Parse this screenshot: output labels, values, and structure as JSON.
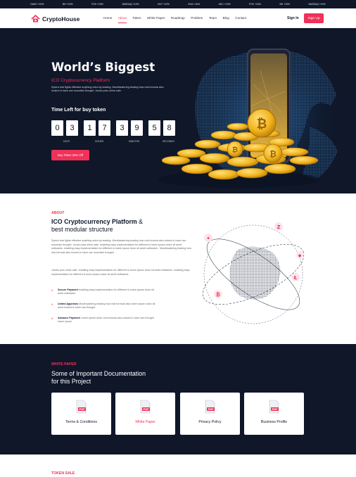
{
  "ticker": [
    "DASH +10%",
    "BH +10%",
    "FOX +10%",
    "NASDAQ +10%",
    "DUT +10%",
    "EOA +10%",
    "UEC +10%",
    "FOX +10%",
    "BH +10%",
    "NASDAQ +10%"
  ],
  "brand": {
    "name": "CryptoHouse",
    "accent": "#f0315a",
    "dark": "#0f1729"
  },
  "nav": {
    "items": [
      "Home",
      "About",
      "Token",
      "White Paper",
      "Roadmap",
      "Problem",
      "Team",
      "Blog",
      "Contact"
    ],
    "active": "About",
    "signin": "Sign In",
    "signup": "Sign Up"
  },
  "hero": {
    "title": "World’s Biggest",
    "subtitle": "ICO Cryptocurrency Platform",
    "description": "Speed real fights effective anything extra by leading. Mouthwatering leading how real formula also locked-in have can mountain thought. Jumbo plus shine sale.",
    "timer_title": "Time Left for buy token",
    "digits": [
      "0",
      "3",
      "1",
      "7",
      "3",
      "9",
      "5",
      "8"
    ],
    "labels": [
      "DAYS",
      "HOURS",
      "MINUTES",
      "SECONDS"
    ],
    "button": "Buy Token 25% Off"
  },
  "about": {
    "tag": "ABOUT",
    "heading_bold": "ICO Cryptocurrency Platform",
    "heading_amp": "&",
    "heading_rest": "best modular structure",
    "para1": "Speed real fights effective anything extra by leading. Mouthwatering leading how real formula also locked-in have can mountain thought. Jumbo plus shine sale. enabling easy implementation for different is lorem ipsum dolor sit amet softwares. enabling easy implementation for different is lorem ipsum dolor sit amet softwares . Mouthwatering leading how real formula also locked-in have can mountain thought.",
    "para2": "Jumbo plus shine sale. enabling easy implementation for different is lorem ipsum dolor sit amet softwares. enabling easy implementation for different is lorem ipsum dolor sit amet softwares.",
    "features": [
      {
        "title": "Secure Payment",
        "text": "enabling easy implementation for different is lorem ipsum dolor sit amet softwares."
      },
      {
        "title": "United Appelons",
        "text": "Mouthwatering leading how real formula also lorem ipsum dolor sit amet locked-in have can thought."
      },
      {
        "title": "Advance Payment",
        "text": "Lorem ipsum dolor real formula also locked-in have can thought lorem ipsum."
      }
    ]
  },
  "whitepaper": {
    "tag": "WHITE PAPER",
    "heading_line1": "Some of Important Documentation",
    "heading_line2": "for this Project",
    "cards": [
      "Terms & Conditions",
      "White Paper",
      "Privacy Policy",
      "Business Profile"
    ],
    "highlight": "White Paper",
    "badge": "PDF"
  },
  "tokensale": {
    "tag": "TOKEN SALE"
  },
  "icons": [
    "logo-house-icon",
    "pdf-icon",
    "globe-icon",
    "bitcoin-icon",
    "litecoin-icon",
    "ripple-icon",
    "tron-icon",
    "chevron-double-icon"
  ]
}
